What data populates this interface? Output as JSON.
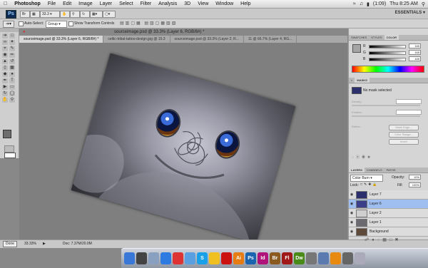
{
  "menubar": {
    "app": "Photoshop",
    "items": [
      "File",
      "Edit",
      "Image",
      "Layer",
      "Select",
      "Filter",
      "Analysis",
      "3D",
      "View",
      "Window",
      "Help"
    ],
    "battery": "(1:09)",
    "clock": "Thu 8:25 AM"
  },
  "appbar": {
    "badge": "Ps",
    "zoom": "33.3",
    "workspace": "ESSENTIALS"
  },
  "options": {
    "auto_select": "Auto-Select:",
    "auto_select_value": "Group",
    "show_transform": "Show Transform Controls"
  },
  "window_title": "sourceimage.psd @ 33.3% (Layer 6, RGB/8#) *",
  "tabs": [
    "sourceimage.psd @ 33.3% (Layer 6, RGB/8#) *",
    "celtic-tribal-tattoo-design.jpg @ 15.3",
    "sourceimage.psd @ 33.3% (Layer 2, R...",
    "11 @ 66.7% (Layer 4, RG..."
  ],
  "status": {
    "zoom": "33.33%",
    "doc": "Doc: 7.37M/20.0M"
  },
  "done": "Done",
  "panels": {
    "color_tabs": [
      "SWATCHES",
      "STYLES",
      "COLOR"
    ],
    "rgb": [
      {
        "ch": "R",
        "val": "165"
      },
      {
        "ch": "G",
        "val": "165"
      },
      {
        "ch": "B",
        "val": "165"
      }
    ],
    "adj_tabs": [
      "MASKS"
    ],
    "mask_label": "No mask selected",
    "density": "Density:",
    "feather": "Feather:",
    "refine": "Refine:",
    "mask_edge": "Mask Edge...",
    "color_range": "Color Range...",
    "invert": "Invert",
    "layer_tabs": [
      "LAYERS",
      "CHANNELS",
      "PATHS"
    ],
    "blend": "Color Burn",
    "opacity_label": "Opacity:",
    "opacity": "10%",
    "lock_label": "Lock:",
    "fill_label": "Fill:",
    "fill": "100%",
    "layers": [
      {
        "name": "Layer 7",
        "selected": false,
        "thumb": "#2b2f6e"
      },
      {
        "name": "Layer 6",
        "selected": true,
        "thumb": "#3a3f8a"
      },
      {
        "name": "Layer 2",
        "selected": false,
        "thumb": "#cfcfcf"
      },
      {
        "name": "Layer 1",
        "selected": false,
        "thumb": "#6a6a70"
      },
      {
        "name": "Background",
        "selected": false,
        "thumb": "#5e4a3a"
      }
    ]
  },
  "dock": [
    {
      "icon": "finder-icon",
      "color": "#3a78d8",
      "label": ""
    },
    {
      "icon": "dashboard-icon",
      "color": "#444",
      "label": ""
    },
    {
      "icon": "mail-icon",
      "color": "#8aa0c0",
      "label": ""
    },
    {
      "icon": "safari-icon",
      "color": "#2d7be0",
      "label": ""
    },
    {
      "icon": "ical-icon",
      "color": "#d33",
      "label": ""
    },
    {
      "icon": "itunes-icon",
      "color": "#5aa0e0",
      "label": ""
    },
    {
      "icon": "skype-icon",
      "color": "#1aa0e8",
      "label": "S"
    },
    {
      "icon": "adium-icon",
      "color": "#f0c020",
      "label": ""
    },
    {
      "icon": "acrobat-icon",
      "color": "#c11",
      "label": ""
    },
    {
      "icon": "illustrator-icon",
      "color": "#e77d12",
      "label": "Ai"
    },
    {
      "icon": "photoshop-icon",
      "color": "#1b64b0",
      "label": "Ps"
    },
    {
      "icon": "indesign-icon",
      "color": "#b0147a",
      "label": "Id"
    },
    {
      "icon": "bridge-icon",
      "color": "#8a5a20",
      "label": "Br"
    },
    {
      "icon": "flash-icon",
      "color": "#a01818",
      "label": "Fl"
    },
    {
      "icon": "dreamweaver-icon",
      "color": "#4a8a18",
      "label": "Dw"
    },
    {
      "icon": "app-icon",
      "color": "#777",
      "label": ""
    },
    {
      "icon": "folder-icon",
      "color": "#5a7ab0",
      "label": ""
    },
    {
      "icon": "vlc-icon",
      "color": "#e88a10",
      "label": ""
    },
    {
      "icon": "utility-icon",
      "color": "#666",
      "label": ""
    },
    {
      "icon": "trash-icon",
      "color": "#aab",
      "label": ""
    }
  ]
}
